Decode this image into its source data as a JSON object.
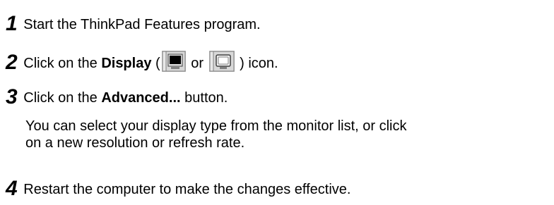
{
  "steps": [
    {
      "number": "1",
      "text": "Start the ThinkPad Features program."
    },
    {
      "number": "2",
      "prefix": "Click on the ",
      "bold": "Display",
      "open_paren": " (",
      "or_word": " or ",
      "close": " ) icon.",
      "icons": [
        "display-monitor-icon",
        "display-lcd-icon"
      ]
    },
    {
      "number": "3",
      "prefix": "Click on the ",
      "bold": "Advanced...",
      "suffix": " button.",
      "note_line1": "You can select your display type from the monitor list, or click",
      "note_line2": "on a new resolution or refresh rate."
    },
    {
      "number": "4",
      "text": "Restart the computer to make the changes effective."
    }
  ]
}
